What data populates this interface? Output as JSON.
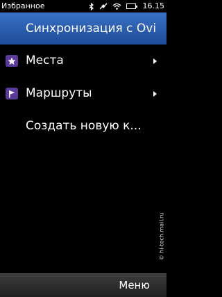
{
  "status_bar": {
    "left_text": "Избранное",
    "time": "16.15",
    "icons": [
      "bluetooth-icon",
      "satellite-icon",
      "wifi-icon",
      "battery-icon"
    ],
    "battery_level": 1.0
  },
  "title_bar": {
    "title": "Синхронизация с Ovi"
  },
  "menu": {
    "items": [
      {
        "label": "Места",
        "icon": "star-icon",
        "has_submenu": true
      },
      {
        "label": "Маршруты",
        "icon": "flag-icon",
        "has_submenu": true
      },
      {
        "label": "Создать новую к...",
        "has_submenu": false
      }
    ]
  },
  "watermark": "© hi-tech.mail.ru",
  "bottom_bar": {
    "menu_label": "Меню"
  },
  "colors": {
    "title_bar": "#2e5fb3",
    "icon_bg": "#5b3a99",
    "background": "#000000",
    "bottom_bar": "#2c2c2c"
  }
}
